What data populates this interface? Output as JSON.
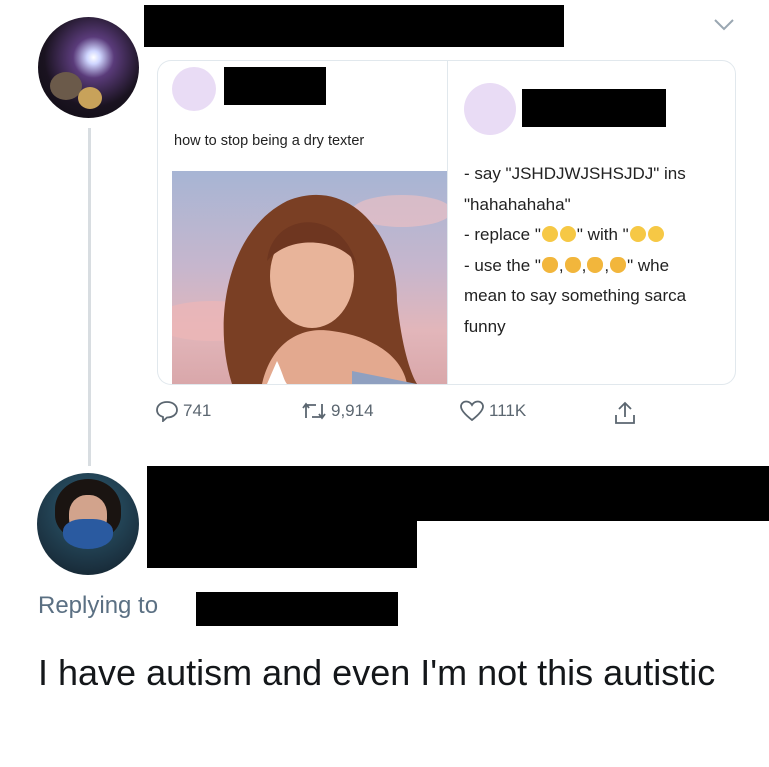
{
  "tweet": {
    "embedded_left": {
      "text": "how to stop being a dry texter"
    },
    "embedded_right": {
      "lines": [
        "- say \"JSHDJWJSHSJDJ\" ins",
        "\"hahahahaha\"",
        "- replace \"",
        "\" with \"",
        "- use the \"",
        "\" whe",
        "mean to say something sarca",
        "funny"
      ]
    },
    "actions": {
      "replies": "741",
      "retweets": "9,914",
      "likes": "111K"
    }
  },
  "reply": {
    "replying_to_label": "Replying to",
    "text": "I have autism and even I'm not this autistic"
  },
  "icons": {
    "reply": "reply-icon",
    "retweet": "retweet-icon",
    "like": "heart-icon",
    "share": "share-icon",
    "menu": "chevron-down-icon"
  }
}
